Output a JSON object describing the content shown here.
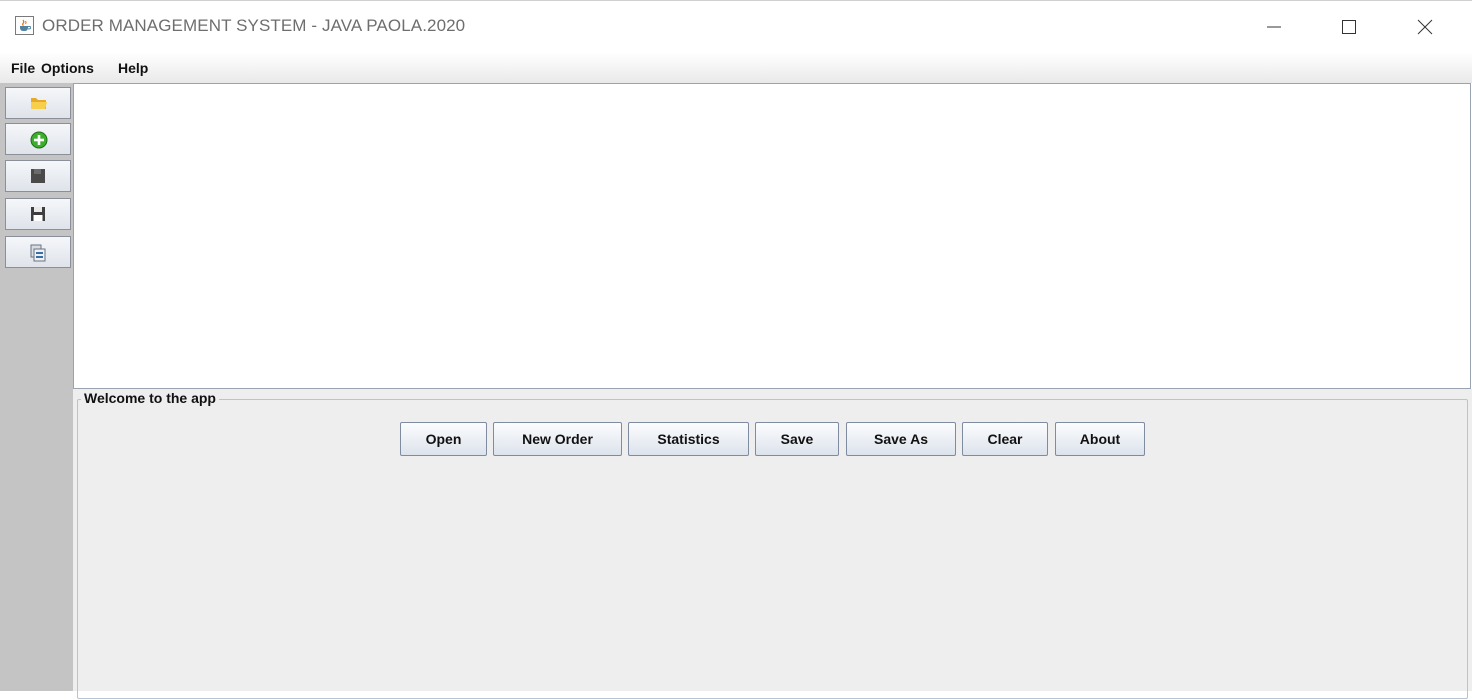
{
  "window": {
    "title": "ORDER MANAGEMENT SYSTEM - JAVA PAOLA.2020",
    "icon": "java-cup-icon",
    "controls": [
      "minimize-icon",
      "maximize-icon",
      "close-icon"
    ]
  },
  "menu": {
    "file": "File",
    "options": "Options",
    "help": "Help"
  },
  "toolbar": {
    "icons": [
      "folder-open-icon",
      "add-circle-icon",
      "save-icon",
      "save-as-icon",
      "statistics-icon"
    ],
    "colors": {
      "folder": "#f5c542",
      "add": "#3cae2c"
    }
  },
  "panel": {
    "title": "Welcome to the app",
    "buttons": {
      "open": "Open",
      "new_order": "New Order",
      "statistics": "Statistics",
      "save": "Save",
      "save_as": "Save As",
      "clear": "Clear",
      "about": "About"
    }
  }
}
